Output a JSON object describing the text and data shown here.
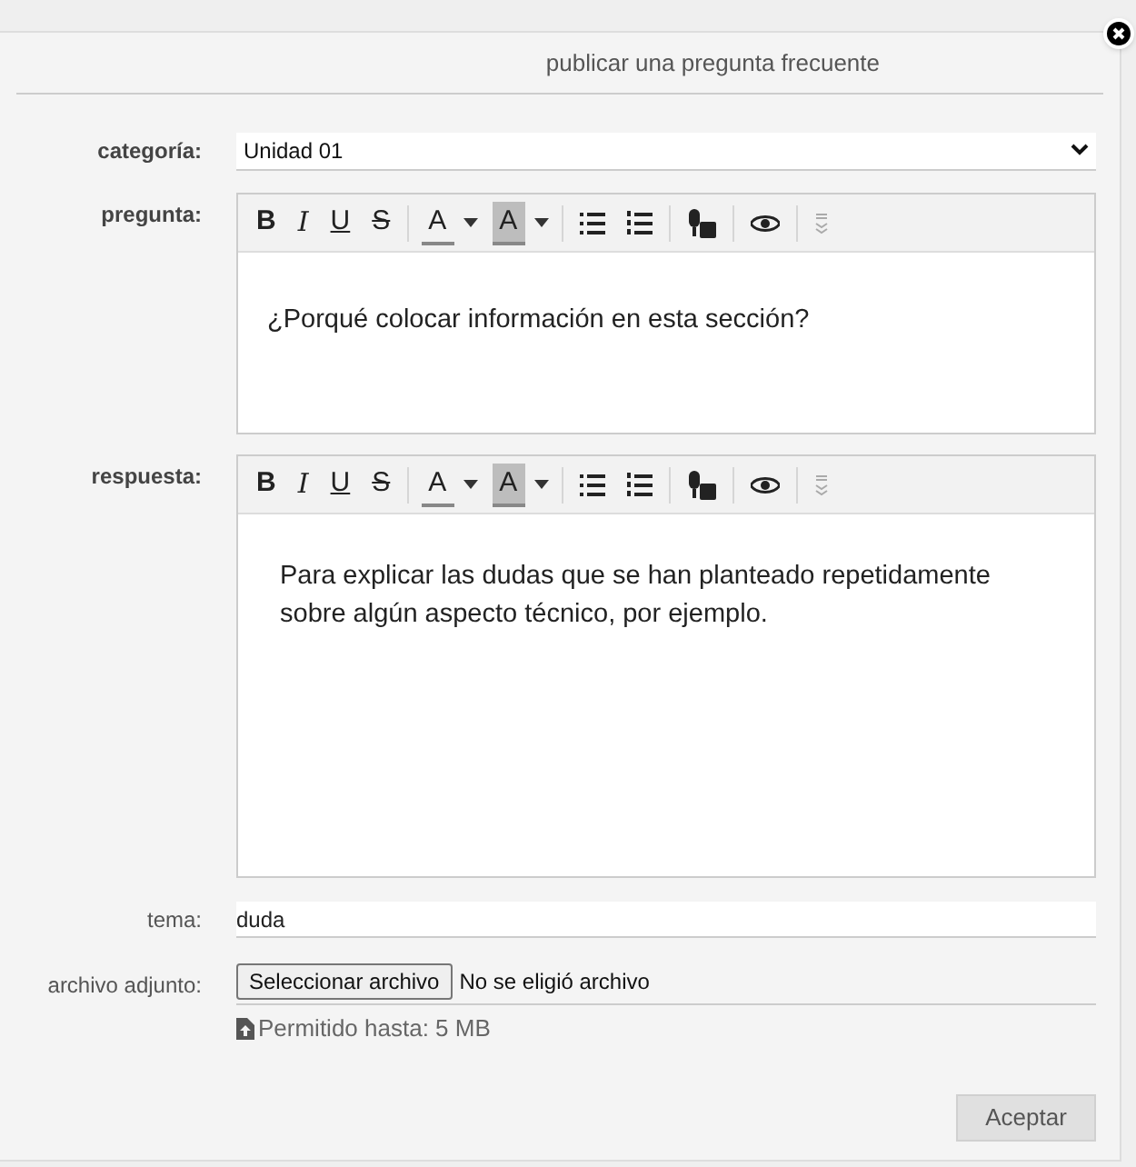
{
  "dialog": {
    "title": "publicar una pregunta frecuente"
  },
  "category": {
    "label": "categoría:",
    "value": "Unidad 01"
  },
  "editors": [
    {
      "label": "pregunta:",
      "text": "¿Porqué colocar información en esta sección?",
      "toolbar": [
        {
          "kind": "bold",
          "label": "B"
        },
        {
          "kind": "italic",
          "label": "I"
        },
        {
          "kind": "underline",
          "label": "U"
        },
        {
          "kind": "strike",
          "label": "S"
        },
        {
          "kind": "sep"
        },
        {
          "kind": "font-color",
          "label": "A"
        },
        {
          "kind": "back-color",
          "label": "A"
        },
        {
          "kind": "sep"
        },
        {
          "kind": "bullets"
        },
        {
          "kind": "numbers"
        },
        {
          "kind": "sep"
        },
        {
          "kind": "speech"
        },
        {
          "kind": "sep"
        },
        {
          "kind": "preview"
        },
        {
          "kind": "sep"
        },
        {
          "kind": "more"
        }
      ]
    },
    {
      "label": "respuesta:",
      "text": "Para explicar las dudas que se han planteado repetidamente sobre algún aspecto técnico, por ejemplo.",
      "toolbar": [
        {
          "kind": "bold",
          "label": "B"
        },
        {
          "kind": "italic",
          "label": "I"
        },
        {
          "kind": "underline",
          "label": "U"
        },
        {
          "kind": "strike",
          "label": "S"
        },
        {
          "kind": "sep"
        },
        {
          "kind": "font-color",
          "label": "A"
        },
        {
          "kind": "back-color",
          "label": "A"
        },
        {
          "kind": "sep"
        },
        {
          "kind": "bullets"
        },
        {
          "kind": "numbers"
        },
        {
          "kind": "sep"
        },
        {
          "kind": "speech"
        },
        {
          "kind": "sep"
        },
        {
          "kind": "preview"
        },
        {
          "kind": "sep"
        },
        {
          "kind": "more"
        }
      ]
    }
  ],
  "topic": {
    "label": "tema:",
    "value": "duda"
  },
  "attachment": {
    "label": "archivo adjunto:",
    "button": "Seleccionar archivo",
    "status": "No se eligió archivo",
    "limit": "Permitido hasta: 5 MB"
  },
  "submit": "Aceptar"
}
